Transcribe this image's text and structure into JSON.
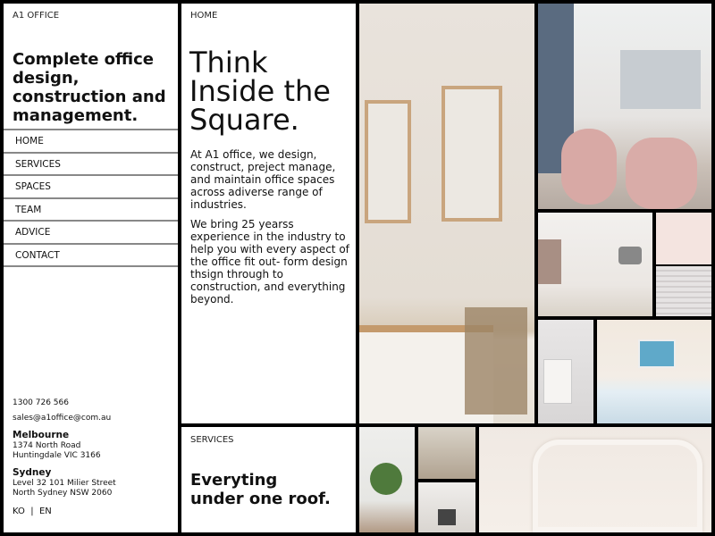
{
  "brand": "A1 OFFICE",
  "tagline": "Complete office design, construction and management.",
  "nav": [
    {
      "label": "HOME"
    },
    {
      "label": "SERVICES"
    },
    {
      "label": "SPACES"
    },
    {
      "label": "TEAM"
    },
    {
      "label": "ADVICE"
    },
    {
      "label": "CONTACT"
    }
  ],
  "contact": {
    "phone": "1300 726 566",
    "email": "sales@a1office@com.au",
    "offices": [
      {
        "city": "Melbourne",
        "line1": "1374 North Road",
        "line2": "Huntingdale VIC 3166"
      },
      {
        "city": "Sydney",
        "line1": "Level 32 101 Milier Street",
        "line2": "North Sydney NSW 2060"
      }
    ],
    "lang": {
      "ko": "KO",
      "sep": "|",
      "en": "EN"
    }
  },
  "home": {
    "crumb": "HOME",
    "headline": "Think Inside the Square.",
    "para1": "At A1 office, we design, construct, preject manage, and maintain office spaces across adiverse range of industries.",
    "para2": "We bring 25 yearss experience in the industry to help you with every aspect of the office fit out- form design thsign through to construction, and everything beyond."
  },
  "services": {
    "crumb": "SERVICES",
    "headline_line1": "Everyting",
    "headline_line2": "under one roof."
  }
}
